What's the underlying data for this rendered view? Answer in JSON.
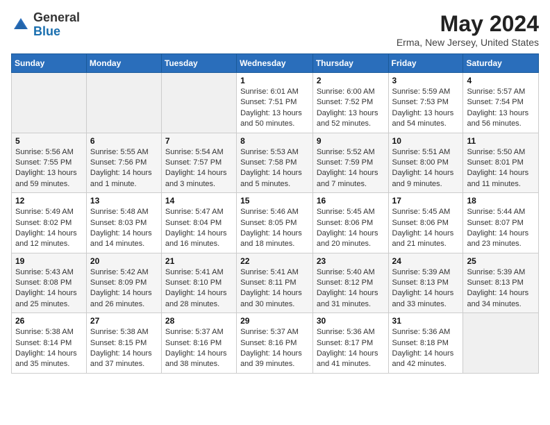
{
  "logo": {
    "general": "General",
    "blue": "Blue"
  },
  "title": "May 2024",
  "subtitle": "Erma, New Jersey, United States",
  "headers": [
    "Sunday",
    "Monday",
    "Tuesday",
    "Wednesday",
    "Thursday",
    "Friday",
    "Saturday"
  ],
  "weeks": [
    [
      {
        "day": "",
        "info": ""
      },
      {
        "day": "",
        "info": ""
      },
      {
        "day": "",
        "info": ""
      },
      {
        "day": "1",
        "info": "Sunrise: 6:01 AM\nSunset: 7:51 PM\nDaylight: 13 hours\nand 50 minutes."
      },
      {
        "day": "2",
        "info": "Sunrise: 6:00 AM\nSunset: 7:52 PM\nDaylight: 13 hours\nand 52 minutes."
      },
      {
        "day": "3",
        "info": "Sunrise: 5:59 AM\nSunset: 7:53 PM\nDaylight: 13 hours\nand 54 minutes."
      },
      {
        "day": "4",
        "info": "Sunrise: 5:57 AM\nSunset: 7:54 PM\nDaylight: 13 hours\nand 56 minutes."
      }
    ],
    [
      {
        "day": "5",
        "info": "Sunrise: 5:56 AM\nSunset: 7:55 PM\nDaylight: 13 hours\nand 59 minutes."
      },
      {
        "day": "6",
        "info": "Sunrise: 5:55 AM\nSunset: 7:56 PM\nDaylight: 14 hours\nand 1 minute."
      },
      {
        "day": "7",
        "info": "Sunrise: 5:54 AM\nSunset: 7:57 PM\nDaylight: 14 hours\nand 3 minutes."
      },
      {
        "day": "8",
        "info": "Sunrise: 5:53 AM\nSunset: 7:58 PM\nDaylight: 14 hours\nand 5 minutes."
      },
      {
        "day": "9",
        "info": "Sunrise: 5:52 AM\nSunset: 7:59 PM\nDaylight: 14 hours\nand 7 minutes."
      },
      {
        "day": "10",
        "info": "Sunrise: 5:51 AM\nSunset: 8:00 PM\nDaylight: 14 hours\nand 9 minutes."
      },
      {
        "day": "11",
        "info": "Sunrise: 5:50 AM\nSunset: 8:01 PM\nDaylight: 14 hours\nand 11 minutes."
      }
    ],
    [
      {
        "day": "12",
        "info": "Sunrise: 5:49 AM\nSunset: 8:02 PM\nDaylight: 14 hours\nand 12 minutes."
      },
      {
        "day": "13",
        "info": "Sunrise: 5:48 AM\nSunset: 8:03 PM\nDaylight: 14 hours\nand 14 minutes."
      },
      {
        "day": "14",
        "info": "Sunrise: 5:47 AM\nSunset: 8:04 PM\nDaylight: 14 hours\nand 16 minutes."
      },
      {
        "day": "15",
        "info": "Sunrise: 5:46 AM\nSunset: 8:05 PM\nDaylight: 14 hours\nand 18 minutes."
      },
      {
        "day": "16",
        "info": "Sunrise: 5:45 AM\nSunset: 8:06 PM\nDaylight: 14 hours\nand 20 minutes."
      },
      {
        "day": "17",
        "info": "Sunrise: 5:45 AM\nSunset: 8:06 PM\nDaylight: 14 hours\nand 21 minutes."
      },
      {
        "day": "18",
        "info": "Sunrise: 5:44 AM\nSunset: 8:07 PM\nDaylight: 14 hours\nand 23 minutes."
      }
    ],
    [
      {
        "day": "19",
        "info": "Sunrise: 5:43 AM\nSunset: 8:08 PM\nDaylight: 14 hours\nand 25 minutes."
      },
      {
        "day": "20",
        "info": "Sunrise: 5:42 AM\nSunset: 8:09 PM\nDaylight: 14 hours\nand 26 minutes."
      },
      {
        "day": "21",
        "info": "Sunrise: 5:41 AM\nSunset: 8:10 PM\nDaylight: 14 hours\nand 28 minutes."
      },
      {
        "day": "22",
        "info": "Sunrise: 5:41 AM\nSunset: 8:11 PM\nDaylight: 14 hours\nand 30 minutes."
      },
      {
        "day": "23",
        "info": "Sunrise: 5:40 AM\nSunset: 8:12 PM\nDaylight: 14 hours\nand 31 minutes."
      },
      {
        "day": "24",
        "info": "Sunrise: 5:39 AM\nSunset: 8:13 PM\nDaylight: 14 hours\nand 33 minutes."
      },
      {
        "day": "25",
        "info": "Sunrise: 5:39 AM\nSunset: 8:13 PM\nDaylight: 14 hours\nand 34 minutes."
      }
    ],
    [
      {
        "day": "26",
        "info": "Sunrise: 5:38 AM\nSunset: 8:14 PM\nDaylight: 14 hours\nand 35 minutes."
      },
      {
        "day": "27",
        "info": "Sunrise: 5:38 AM\nSunset: 8:15 PM\nDaylight: 14 hours\nand 37 minutes."
      },
      {
        "day": "28",
        "info": "Sunrise: 5:37 AM\nSunset: 8:16 PM\nDaylight: 14 hours\nand 38 minutes."
      },
      {
        "day": "29",
        "info": "Sunrise: 5:37 AM\nSunset: 8:16 PM\nDaylight: 14 hours\nand 39 minutes."
      },
      {
        "day": "30",
        "info": "Sunrise: 5:36 AM\nSunset: 8:17 PM\nDaylight: 14 hours\nand 41 minutes."
      },
      {
        "day": "31",
        "info": "Sunrise: 5:36 AM\nSunset: 8:18 PM\nDaylight: 14 hours\nand 42 minutes."
      },
      {
        "day": "",
        "info": ""
      }
    ]
  ]
}
